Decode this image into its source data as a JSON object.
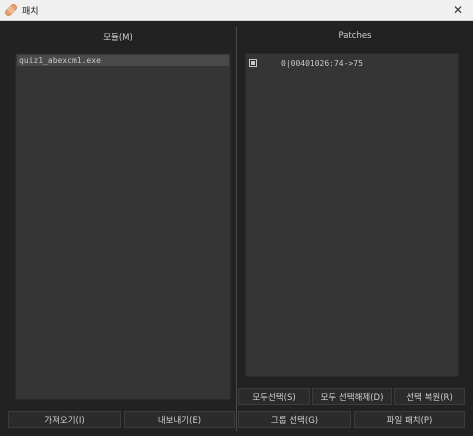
{
  "window": {
    "title": "패치"
  },
  "modules_panel": {
    "title": "모듈(M)",
    "items": [
      "quiz1_abexcm1.exe"
    ]
  },
  "patches_panel": {
    "title": "Patches",
    "items": [
      {
        "checked": true,
        "label": "0|00401026:74->75"
      }
    ]
  },
  "buttons": {
    "import": "가져오기(I)",
    "export": "내보내기(E)",
    "select_all": "모두선택(S)",
    "deselect_all": "모두 선택해제(D)",
    "restore_selection": "선택 복원(R)",
    "group_select": "그룹 선택(G)",
    "patch_file": "파일 패치(P)"
  }
}
